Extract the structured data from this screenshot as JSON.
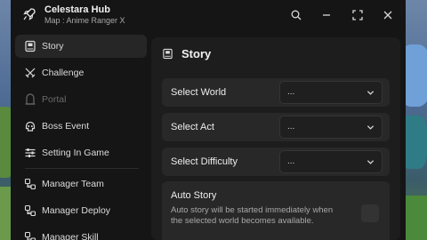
{
  "app": {
    "title": "Celestara Hub",
    "subtitle": "Map : Anime Ranger X"
  },
  "titlebar": {
    "icons": [
      "search-icon",
      "minimize-icon",
      "maximize-icon",
      "close-icon"
    ]
  },
  "sidebar": {
    "items": [
      {
        "label": "Story",
        "icon": "book-icon",
        "active": true
      },
      {
        "label": "Challenge",
        "icon": "crossed-swords-icon"
      },
      {
        "label": "Portal",
        "icon": "portal-icon",
        "disabled": true
      },
      {
        "label": "Boss Event",
        "icon": "skull-icon"
      },
      {
        "label": "Setting In Game",
        "icon": "sliders-icon"
      },
      {
        "label": "Manager Team",
        "icon": "manager-icon"
      },
      {
        "label": "Manager Deploy",
        "icon": "manager-icon"
      },
      {
        "label": "Manager Skill",
        "icon": "manager-icon"
      }
    ]
  },
  "content": {
    "title": "Story",
    "rows": [
      {
        "label": "Select World",
        "value": "..."
      },
      {
        "label": "Select Act",
        "value": "..."
      },
      {
        "label": "Select Difficulty",
        "value": "..."
      }
    ],
    "auto_story": {
      "label": "Auto Story",
      "description": "Auto story will be started immediately when the selected world becomes available.",
      "checked": false
    }
  },
  "colors": {
    "window_bg": "#151515",
    "panel_bg": "#1d1d1d",
    "row_bg": "#282828",
    "active_item_bg": "#262626",
    "text": "#e8e8e8",
    "muted": "#a8a8a8"
  }
}
